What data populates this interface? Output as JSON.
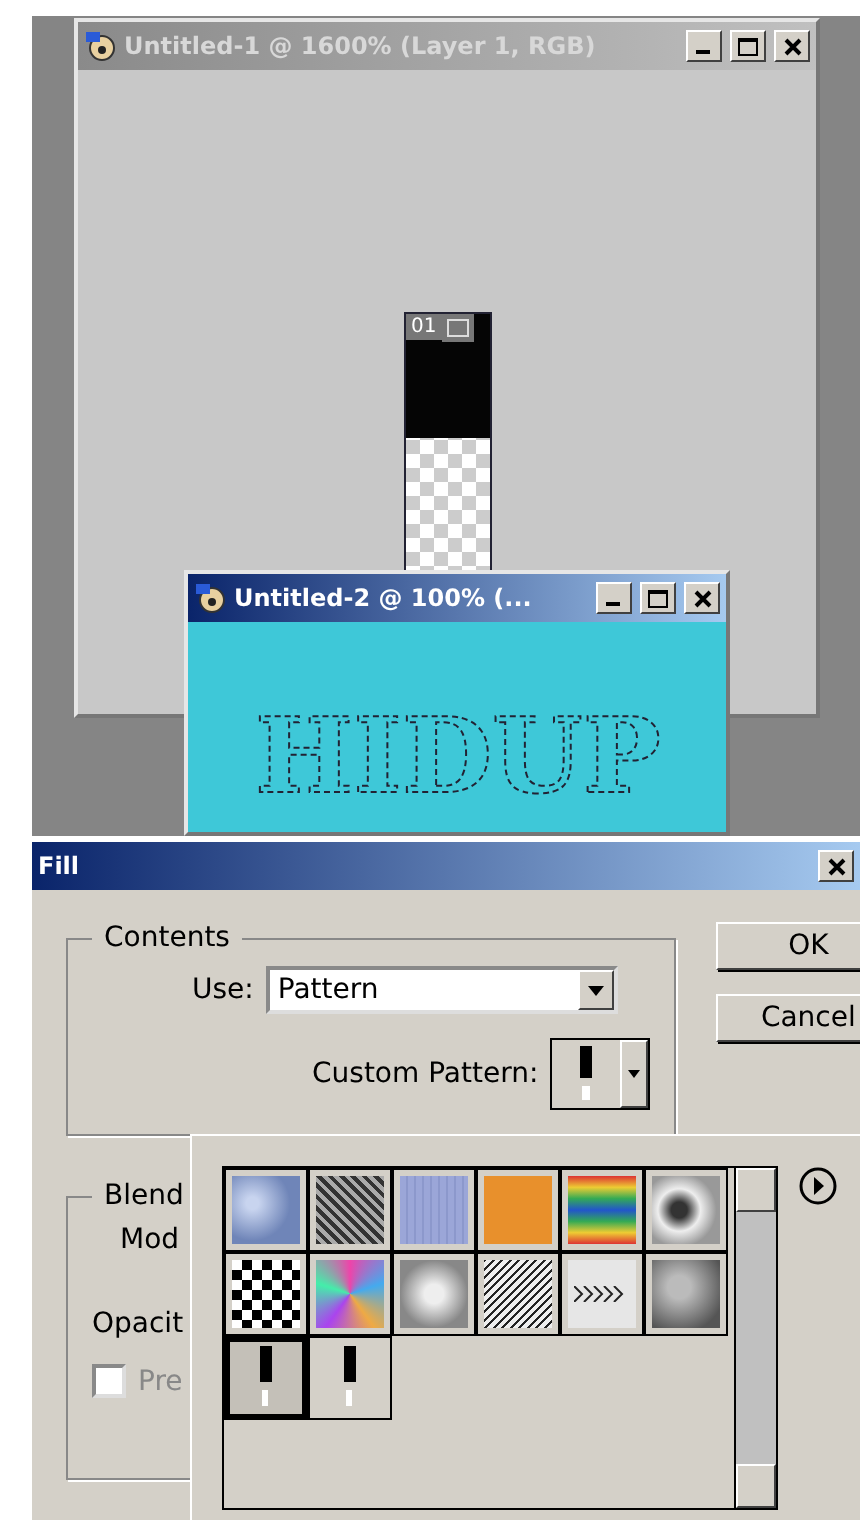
{
  "windows": [
    {
      "kind": "slice",
      "title": "Untitled-1 @ 1600% (Layer 1, RGB)",
      "active": false,
      "slice_label": "01"
    },
    {
      "kind": "text",
      "title": "Untitled-2 @ 100% (...",
      "active": true,
      "canvas_text": "HIDUP"
    }
  ],
  "dialog": {
    "title": "Fill",
    "contents": {
      "legend": "Contents",
      "use_label": "Use:",
      "use_value": "Pattern",
      "custom_pattern_label": "Custom Pattern:"
    },
    "buttons": [
      "OK",
      "Cancel"
    ],
    "blending": {
      "legend": "Blend",
      "mode_label": "Mod",
      "opacity_label": "Opacit",
      "preserve": {
        "label": "Pre",
        "checked": false
      }
    }
  },
  "pattern_picker": {
    "patterns": [
      {
        "kind": "bubbles",
        "selected": false
      },
      {
        "kind": "noise",
        "selected": false
      },
      {
        "kind": "blue",
        "selected": false
      },
      {
        "kind": "orange",
        "selected": false
      },
      {
        "kind": "rainbow",
        "selected": false
      },
      {
        "kind": "marble",
        "selected": false
      },
      {
        "kind": "checker",
        "selected": false
      },
      {
        "kind": "confetti",
        "selected": false
      },
      {
        "kind": "clouds",
        "selected": false
      },
      {
        "kind": "speckle",
        "selected": false
      },
      {
        "kind": "arrows",
        "selected": false
      },
      {
        "kind": "smoke",
        "selected": false
      },
      {
        "kind": "slice",
        "selected": true
      },
      {
        "kind": "slice",
        "selected": false
      }
    ]
  }
}
